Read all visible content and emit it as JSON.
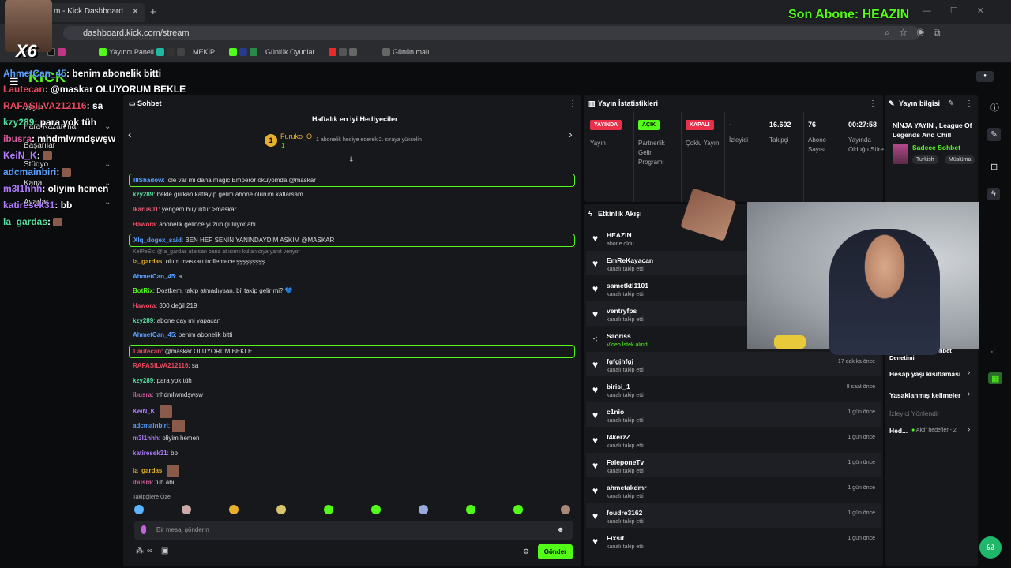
{
  "browser": {
    "tab_title": "m - Kick Dashboard",
    "url": "dashboard.kick.com/stream",
    "bookmarks": [
      "Yayıncı Paneli",
      "MEKİP",
      "Günlük Oyunlar",
      "Günün malı"
    ]
  },
  "overlay": {
    "last_sub": "Son Abone: HEAZIN",
    "multiplier": "X6",
    "brand": "KICK",
    "chat": [
      {
        "user": "AhmetCan_45",
        "text": ": benim abonelik bitti",
        "color": "#5aa0ff"
      },
      {
        "user": "Lautecan",
        "text": ": @maskar OLUYORUM BEKLE",
        "color": "#e84a5f"
      },
      {
        "user": "RAFASILVA212116",
        "text": ": sa",
        "color": "#e84a5f"
      },
      {
        "user": "kzy289",
        "text": ": para yok tüh",
        "color": "#53e0a0"
      },
      {
        "user": "ibusra",
        "text": ": mhdmlwmdşwşw",
        "color": "#d85aa0"
      },
      {
        "user": "KeiN_K",
        "text": ":",
        "color": "#b07cff"
      },
      {
        "user": "adcmainbiri",
        "text": ":",
        "color": "#5aa0ff"
      },
      {
        "user": "m3l1hhh",
        "text": ": oliyim hemen",
        "color": "#b07cff"
      },
      {
        "user": "katiresek31",
        "text": ": bb",
        "color": "#b07cff"
      },
      {
        "user": "la_gardas",
        "text": ":",
        "color": "#53e0a0"
      }
    ]
  },
  "sidebar": {
    "items": [
      {
        "label": "Yayın"
      },
      {
        "label": "Para Kazanma"
      },
      {
        "label": "Başarılar"
      },
      {
        "label": "Stüdyo"
      },
      {
        "label": "Kanal"
      },
      {
        "label": "Ayarlar"
      }
    ]
  },
  "chat": {
    "title": "Sohbet",
    "gifters_title": "Haftalık en iyi Hediyeciler",
    "top_gifter": {
      "rank": "1",
      "name": "Furuko_O",
      "count": "1"
    },
    "gifter_hint": "1 abonelik hediye ederek 2. sıraya yükselin",
    "messages": [
      {
        "user": "lllShadow",
        "text": ": lole var mı daha magic Emperor okuyomda @maskar",
        "color": "#5aa0ff",
        "hl": true
      },
      {
        "user": "kzy289",
        "text": ": bekle gürkan katlayıp gelim abone olurum katlarsam",
        "color": "#53e0a0"
      },
      {
        "user": "Ikarus01",
        "text": ": yengem büyüktür >maskar",
        "color": "#e8607a"
      },
      {
        "user": "Hawora",
        "text": ": abonelik gelince yüzün gülüyor abi",
        "color": "#e84a5f"
      },
      {
        "user": "Xlq_dogex_said",
        "text": ": BEN HEP SENİN YANINDAYDIM ASKİM @MASKAR",
        "color": "#5aa0ff",
        "hl": true
      },
      {
        "user": "la_gardas",
        "text": ": olum maskarı trollemece şşşşşşşşş",
        "color": "#e8b02a"
      },
      {
        "user": "AhmetCan_45",
        "text": ": a",
        "color": "#5aa0ff"
      },
      {
        "user": "BotRix",
        "text": ": Dostkem, takip atmadıysan, bi' takip gelir mi? 💙",
        "color": "#53fc18"
      },
      {
        "user": "Hawora",
        "text": ": 300 değil 219",
        "color": "#e84a5f"
      },
      {
        "user": "kzy289",
        "text": ": abone day mi yapacan",
        "color": "#53e0a0"
      },
      {
        "user": "AhmetCan_45",
        "text": ": benim abonelik bitti",
        "color": "#5aa0ff"
      },
      {
        "user": "Lautecan",
        "text": ": @maskar OLUYORUM BEKLE",
        "color": "#e84a5f",
        "hl": true
      },
      {
        "user": "RAFASILVA212116",
        "text": ": sa",
        "color": "#e84a5f"
      },
      {
        "user": "kzy289",
        "text": ": para yok tüh",
        "color": "#53e0a0"
      },
      {
        "user": "ibusra",
        "text": ": mhdmlwmdşwşw",
        "color": "#d85aa0"
      },
      {
        "user": "KeiN_K",
        "text": ":",
        "color": "#b07cff"
      },
      {
        "user": "adcmainbiri",
        "text": ":",
        "color": "#5aa0ff"
      },
      {
        "user": "m3l1hhh",
        "text": ": oliyim hemen",
        "color": "#b07cff"
      },
      {
        "user": "katiresek31",
        "text": ": bb",
        "color": "#b07cff"
      },
      {
        "user": "la_gardas",
        "text": ":",
        "color": "#e8b02a"
      },
      {
        "user": "ibusra",
        "text": ": tüh abi",
        "color": "#d85aa0"
      }
    ],
    "reply_hint": "KelPeEk: @la_gardas atarsan bana at isimli kullanıcıya yanıt veriyor",
    "followers_only": "Takipçilere Özel",
    "input_placeholder": "Bir mesaj gönderin",
    "send_label": "Gönder"
  },
  "stats": {
    "title": "Yayın İstatistikleri",
    "cols": [
      {
        "badge": "YAYINDA",
        "label": "Yayın",
        "badge_color": "#e8304a"
      },
      {
        "badge": "AÇIK",
        "label": "Partnerlik Gelir Programı",
        "badge_color": "#53fc18"
      },
      {
        "badge": "KAPALI",
        "label": "Çoklu Yayın",
        "badge_color": "#e8304a"
      },
      {
        "value": "-",
        "label": "İzleyici"
      },
      {
        "value": "16.602",
        "label": "Takipçi"
      },
      {
        "value": "76",
        "label": "Abone Sayısı"
      },
      {
        "value": "00:27:58",
        "label": "Yayında Olduğu Süre"
      }
    ]
  },
  "info": {
    "title": "Yayın bilgisi",
    "stream_title": "NİNJA YAYIN , League Of Legends And Chill",
    "category": "Sadece Sohbet",
    "tags": [
      "Turkish",
      "Müslüma"
    ],
    "items": [
      {
        "label": "Yapay Zeka ile Sohbet Denetimi"
      },
      {
        "label": "Hesap yaşı kısıtlaması"
      },
      {
        "label": "Yasaklanmış kelimeler"
      },
      {
        "label": "İzleyici Yönlendir"
      },
      {
        "label": "Hed...",
        "extra": "Aktif hedefler - 2"
      }
    ]
  },
  "activity": {
    "title": "Etkinlik Akışı",
    "events": [
      {
        "name": "HEAZIN",
        "sub": "abone oldu",
        "time": ""
      },
      {
        "name": "EmReKayacan",
        "sub": "kanalı takip etti",
        "time": ""
      },
      {
        "name": "sametktl1101",
        "sub": "kanalı takip etti",
        "time": ""
      },
      {
        "name": "ventryfps",
        "sub": "kanalı takip etti",
        "time": ""
      },
      {
        "name": "Saoriss",
        "sub": "Video İstek alındı",
        "time": ""
      },
      {
        "name": "fgfgjhfgj",
        "sub": "kanalı takip etti",
        "time": "17 dakika önce"
      },
      {
        "name": "birisi_1",
        "sub": "kanalı takip etti",
        "time": "8 saat önce"
      },
      {
        "name": "c1nio",
        "sub": "kanalı takip etti",
        "time": "1 gün önce"
      },
      {
        "name": "f4kerzZ",
        "sub": "kanalı takip etti",
        "time": "1 gün önce"
      },
      {
        "name": "FaleponeTv",
        "sub": "kanalı takip etti",
        "time": "1 gün önce"
      },
      {
        "name": "ahmetakdmr",
        "sub": "kanalı takip etti",
        "time": "1 gün önce"
      },
      {
        "name": "foudre3162",
        "sub": "kanalı takip etti",
        "time": "1 gün önce"
      },
      {
        "name": "Fixsit",
        "sub": "kanalı takip etti",
        "time": "1 gün önce"
      }
    ]
  }
}
